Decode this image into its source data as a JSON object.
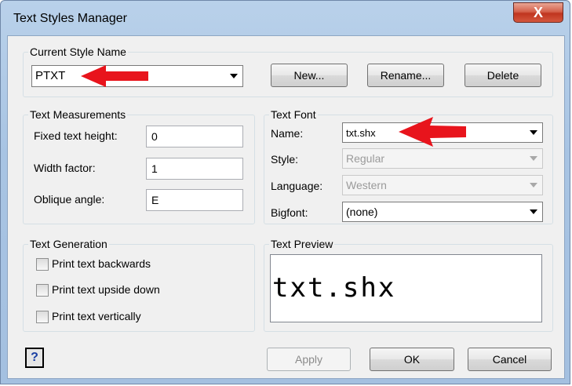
{
  "window": {
    "title": "Text Styles Manager",
    "close_label": "X"
  },
  "current_style": {
    "group_label": "Current Style Name",
    "selected": "PTXT",
    "new_label": "New...",
    "rename_label": "Rename...",
    "delete_label": "Delete"
  },
  "measurements": {
    "group_label": "Text Measurements",
    "fixed_height_label": "Fixed text height:",
    "fixed_height_value": "0",
    "width_factor_label": "Width factor:",
    "width_factor_value": "1",
    "oblique_label": "Oblique angle:",
    "oblique_value": "E"
  },
  "font": {
    "group_label": "Text Font",
    "name_label": "Name:",
    "name_value": "txt.shx",
    "style_label": "Style:",
    "style_value": "Regular",
    "language_label": "Language:",
    "language_value": "Western",
    "bigfont_label": "Bigfont:",
    "bigfont_value": "(none)"
  },
  "generation": {
    "group_label": "Text Generation",
    "backwards_label": "Print text backwards",
    "upside_down_label": "Print text upside down",
    "vertically_label": "Print text vertically"
  },
  "preview": {
    "group_label": "Text Preview",
    "text": "txt.shx"
  },
  "footer": {
    "help_label": "?",
    "apply_label": "Apply",
    "ok_label": "OK",
    "cancel_label": "Cancel"
  },
  "colors": {
    "annotation_arrow": "#e8141c",
    "title_bar": "#b9d1ea",
    "dialog_bg": "#f0f0f0"
  }
}
